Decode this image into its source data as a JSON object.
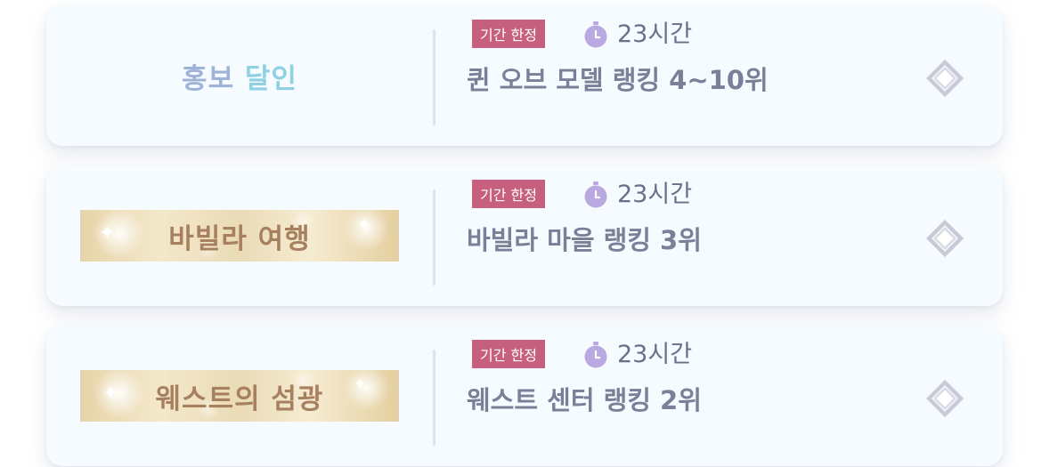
{
  "missions": [
    {
      "title_part1": "홍보",
      "title_part2": "달인",
      "badge": "기간 한정",
      "time_left": "23시간",
      "description": "퀸 오브 모델 랭킹 4~10위"
    },
    {
      "title": "바빌라 여행",
      "badge": "기간 한정",
      "time_left": "23시간",
      "description": "바빌라 마을 랭킹 3위"
    },
    {
      "title": "웨스트의 섬광",
      "badge": "기간 한정",
      "time_left": "23시간",
      "description": "웨스트 센터 랭킹 2위"
    }
  ],
  "colors": {
    "badge": "#c7607f",
    "timer_icon": "#b9a9e0",
    "card_bg": "#f5fbfe",
    "text": "#7b8099",
    "gold_text": "#a7815f"
  },
  "icons": {
    "timer": "stopwatch-icon",
    "go": "diamond-go-icon"
  }
}
